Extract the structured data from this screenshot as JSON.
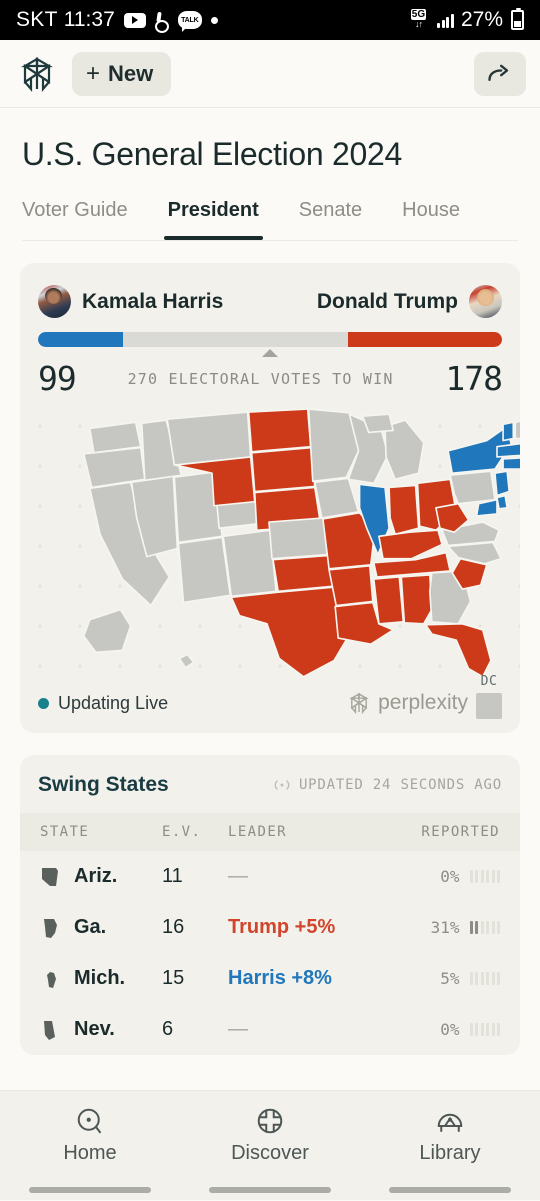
{
  "status_bar": {
    "carrier": "SKT",
    "time": "11:37",
    "left_icons": [
      "youtube-icon",
      "music-icon",
      "kakaotalk-icon",
      "dot-icon"
    ],
    "network": "5G",
    "battery_percent": "27%",
    "right_icons": [
      "5g-icon",
      "signal-icon",
      "battery-icon"
    ]
  },
  "app_bar": {
    "logo": "perplexity-logo",
    "new_label": "New",
    "new_plus": "+",
    "share_icon": "share-icon"
  },
  "page": {
    "title": "U.S. General Election 2024"
  },
  "tabs": [
    {
      "label": "Voter Guide",
      "active": false
    },
    {
      "label": "President",
      "active": true
    },
    {
      "label": "Senate",
      "active": false
    },
    {
      "label": "House",
      "active": false
    }
  ],
  "president": {
    "left_candidate": {
      "name": "Kamala Harris",
      "votes": "99",
      "color": "#2077BC",
      "avatar": "kamala-harris-avatar"
    },
    "right_candidate": {
      "name": "Donald Trump",
      "votes": "178",
      "color": "#CC3A19",
      "avatar": "donald-trump-avatar"
    },
    "threshold_label": "270 ELECTORAL VOTES TO WIN",
    "threshold": 270,
    "total_electoral_votes": 538,
    "live_label": "Updating Live",
    "live_color": "#18808B",
    "brand": "perplexity",
    "dc_label": "DC"
  },
  "map": {
    "neutral_color": "#C6C7C3",
    "harris_color": "#2077BC",
    "trump_color": "#CC3A19",
    "harris_states": [
      "IL",
      "NY",
      "VT",
      "MA",
      "RI",
      "CT",
      "NJ",
      "DE",
      "MD"
    ],
    "trump_states": [
      "ND",
      "SD",
      "NE",
      "WY",
      "TX",
      "OK",
      "AR",
      "LA",
      "MS",
      "AL",
      "TN",
      "KY",
      "IN",
      "OH",
      "WV",
      "SC",
      "FL",
      "MO"
    ]
  },
  "swing_states": {
    "title": "Swing States",
    "updated_label": "UPDATED 24 SECONDS AGO",
    "live_icon": "broadcast-icon",
    "columns": [
      "STATE",
      "E.V.",
      "LEADER",
      "REPORTED"
    ],
    "rows": [
      {
        "state": "Ariz.",
        "icon": "arizona-shape-icon",
        "ev": "11",
        "leader": "—",
        "leader_type": "none",
        "reported": "0%",
        "reported_value": 0
      },
      {
        "state": "Ga.",
        "icon": "georgia-shape-icon",
        "ev": "16",
        "leader": "Trump +5%",
        "leader_type": "trump",
        "reported": "31%",
        "reported_value": 31
      },
      {
        "state": "Mich.",
        "icon": "michigan-shape-icon",
        "ev": "15",
        "leader": "Harris +8%",
        "leader_type": "harris",
        "reported": "5%",
        "reported_value": 5
      },
      {
        "state": "Nev.",
        "icon": "nevada-shape-icon",
        "ev": "6",
        "leader": "—",
        "leader_type": "none",
        "reported": "0%",
        "reported_value": 0
      }
    ]
  },
  "bottom_nav": [
    {
      "label": "Home",
      "icon": "home-search-icon"
    },
    {
      "label": "Discover",
      "icon": "discover-globe-icon"
    },
    {
      "label": "Library",
      "icon": "library-icon"
    }
  ]
}
